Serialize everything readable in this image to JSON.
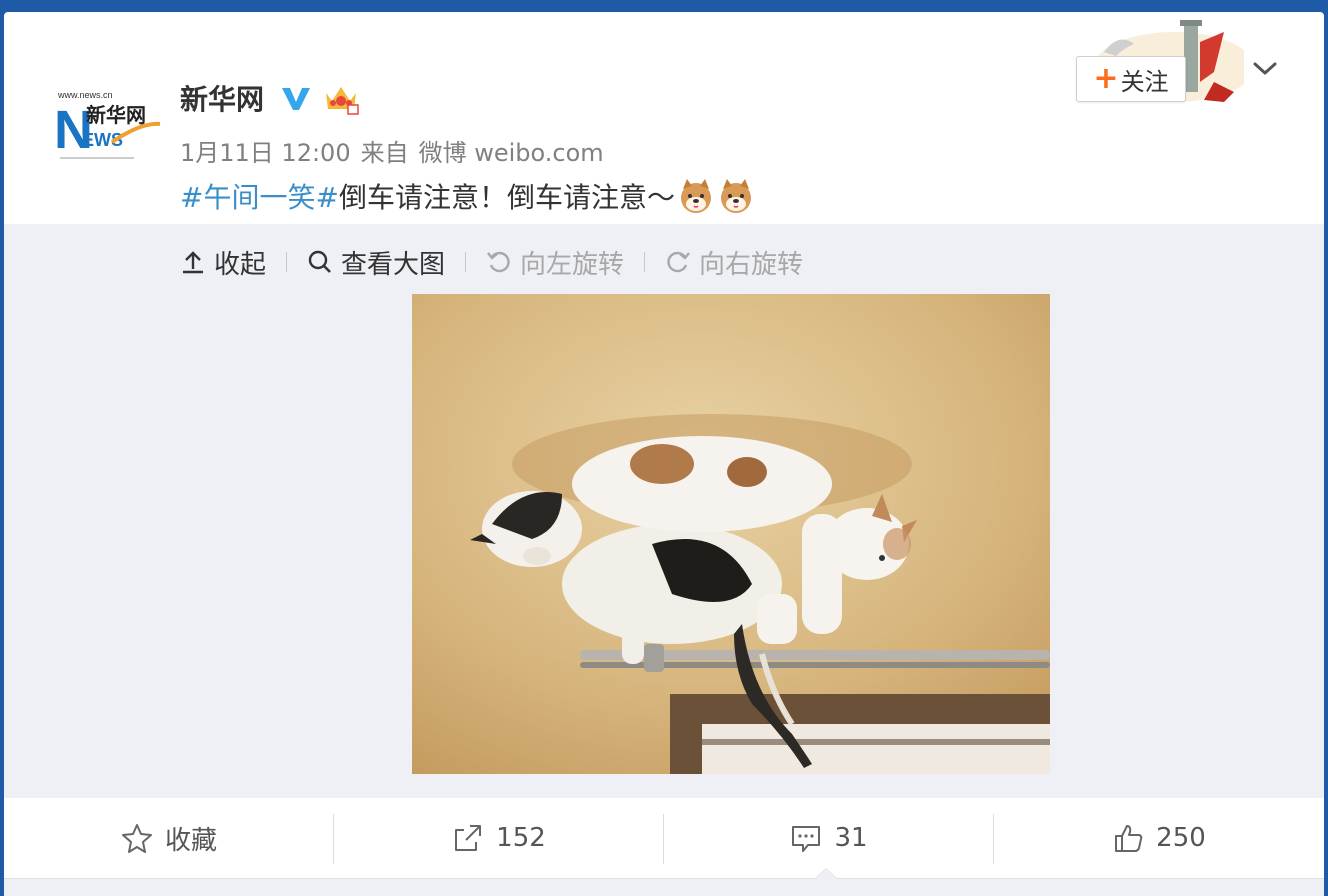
{
  "post": {
    "author": "新华网",
    "date": "1月11日 12:00",
    "source_prefix": "来自",
    "source": "微博 weibo.com",
    "topic": "#午间一笑#",
    "body": "倒车请注意！倒车请注意～",
    "emoji": "dog-face-emoji",
    "follow_plus": "+",
    "follow_label": "关注"
  },
  "toolbar": {
    "collapse": "收起",
    "view_large": "查看大图",
    "rotate_left": "向左旋转",
    "rotate_right": "向右旋转"
  },
  "actions": {
    "favorite": "收藏",
    "repost_count": "152",
    "comment_count": "31",
    "like_count": "250"
  },
  "colors": {
    "topic": "#3a8fc8",
    "verified": "#36a6ec",
    "follow_plus": "#ff6a1c",
    "media_bg": "#eef0f5",
    "page_bg": "#1f5aa6"
  },
  "avatar": {
    "logo_text": "新华网",
    "logo_initial": "N",
    "logo_news": "EWS",
    "logo_url": "www.news.cn"
  }
}
